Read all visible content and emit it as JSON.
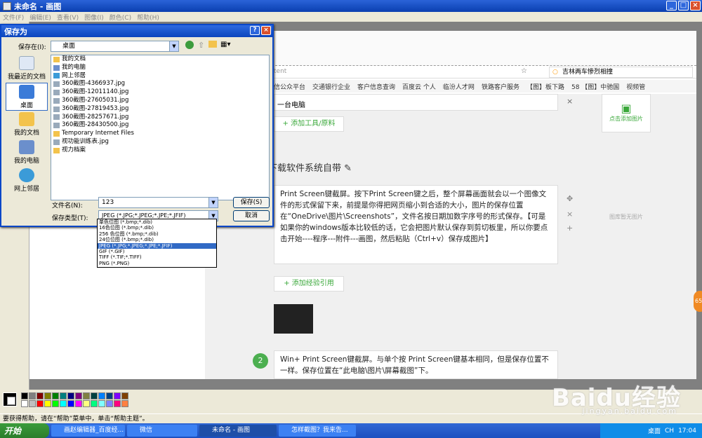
{
  "window": {
    "title": "未命名 - 画图"
  },
  "menu": [
    "文件(F)",
    "编辑(E)",
    "查看(V)",
    "图像(I)",
    "颜色(C)",
    "帮助(H)"
  ],
  "browser": {
    "url": "tent",
    "search": "吉林两车惨烈相撞",
    "bookmarks": [
      "信公众平台",
      "交通银行企业",
      "客户信息查询",
      "百度云 个人",
      "临汾人才网",
      "铁路客户服务",
      "【图】板下路",
      "58 【图】中驰国",
      "视频管"
    ],
    "tool_field": "一台电脑",
    "add_tool": "+ 添加工具/原料",
    "section_title": "下载软件系统自带",
    "step1_text": "Print Screen键截屏。按下Print Screen键之后，整个屏幕画面就会以一个图像文件的形式保留下来，前提是你得把网页缩小到合适的大小，图片的保存位置在“OneDrive\\图片\\Screenshots”，文件名按日期加数字序号的形式保存。【可是如果你的windows版本比较低的话，它会把图片默认保存到剪切板里，所以你要点击开始----程序---附件---画图，然后粘贴（Ctrl+v）保存成图片】",
    "add_ref": "+ 添加经验引用",
    "step2_num": "2",
    "step2_text": "Win+ Print Screen键截屏。与单个按 Print Screen键基本相同，但是保存位置不一样。保存位置在“此电脑\\图片\\屏幕截图”下。",
    "add_image": "点击添加图片",
    "no_image": "图库暂无图片",
    "badge": "65"
  },
  "dialog": {
    "title": "保存为",
    "save_in_label": "保存在(I):",
    "save_in_value": "桌面",
    "places": [
      "我最近的文档",
      "桌面",
      "我的文档",
      "我的电脑",
      "网上邻居"
    ],
    "files": [
      "我的文档",
      "我的电脑",
      "网上邻居",
      "360截图-4366937.jpg",
      "360截图-12011140.jpg",
      "360截图-27605031.jpg",
      "360截图-27819453.jpg",
      "360截图-28257671.jpg",
      "360截图-28430500.jpg",
      "Temporary Internet Files",
      "视功能训练表.jpg",
      "视力档案"
    ],
    "filename_label": "文件名(N):",
    "filename_value": "123",
    "filetype_label": "保存类型(T):",
    "filetype_value": "JPEG (*.JPG;*.JPEG;*.JPE;*.JFIF)",
    "save_button": "保存(S)",
    "cancel_button": "取消",
    "type_options": [
      "单色位图 (*.bmp;*.dib)",
      "16色位图 (*.bmp;*.dib)",
      "256 色位图 (*.bmp;*.dib)",
      "24位位图 (*.bmp;*.dib)",
      "JPEG (*.JPG;*.JPEG;*.JPE;*.JFIF)",
      "GIF (*.GIF)",
      "TIFF (*.TIF;*.TIFF)",
      "PNG (*.PNG)"
    ]
  },
  "statusbar": "要获得帮助，请在“帮助”菜单中，单击“帮助主题”。",
  "taskbar": {
    "start": "开始",
    "tasks": [
      "画赵编辑器_百度经...",
      "微信",
      "未命名 - 画图",
      "怎样截图？我来告..."
    ],
    "tray_label": "桌面",
    "lang": "CH",
    "time": "17:04"
  },
  "watermark": {
    "logo": "Baidu经验",
    "url": "jingyan.baidu.com"
  }
}
